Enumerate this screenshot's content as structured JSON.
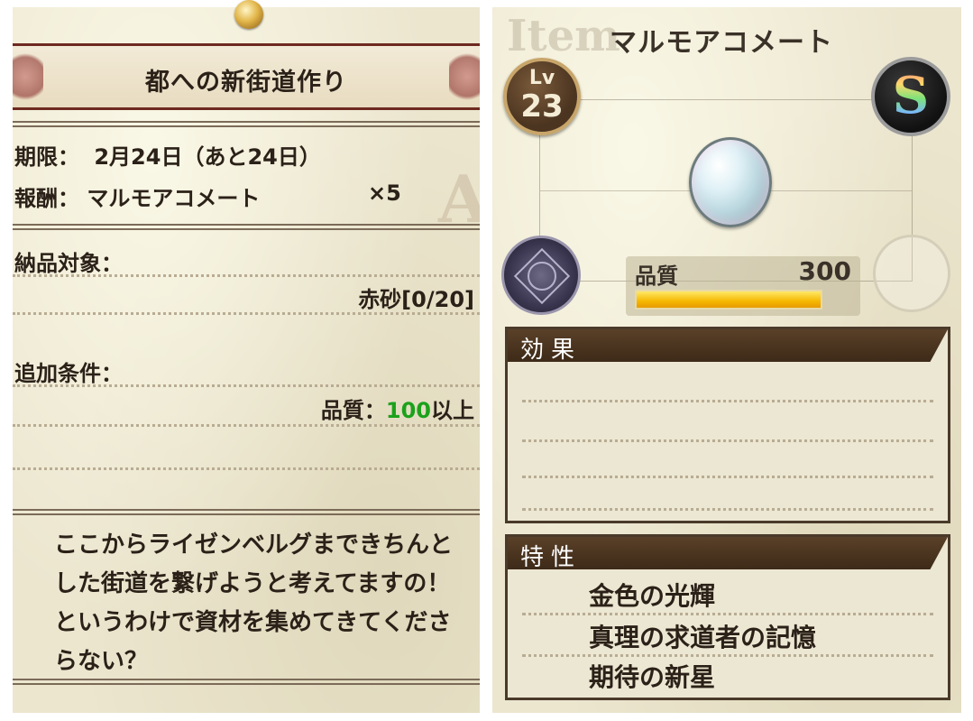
{
  "quest": {
    "title": "都への新街道作り",
    "deadline_label": "期限：",
    "deadline_value": "2月24日（あと24日）",
    "reward_label": "報酬：",
    "reward_item": "マルモアコメート",
    "reward_qty": "×5",
    "delivery_label": "納品対象：",
    "delivery_item": "赤砂[0/20]",
    "extra_label": "追加条件：",
    "condition_prefix": "品質：",
    "condition_value": "100",
    "condition_suffix": "以上",
    "description": "ここからライゼンベルグまできちんとした街道を繋げようと考えてますの！というわけで資材を集めてきてくださらない？",
    "watermark": "A"
  },
  "item": {
    "watermark": "Item",
    "name": "マルモアコメート",
    "level_label": "Lv",
    "level": "23",
    "rank": "S",
    "quality_label": "品質",
    "quality": "300",
    "quality_fill_pct": 100,
    "effects_header": "効果",
    "effects": [],
    "traits_header": "特性",
    "traits": [
      "金色の光輝",
      "真理の求道者の記憶",
      "期待の新星"
    ]
  },
  "colors": {
    "condition_green": "#1ca11c",
    "header_brown": "#4a3a2a",
    "quality_bar": "#f5b800"
  },
  "icons": {
    "pin": "gold-pin-icon",
    "gem": "opal-gem-icon",
    "seal": "magic-seal-icon"
  }
}
